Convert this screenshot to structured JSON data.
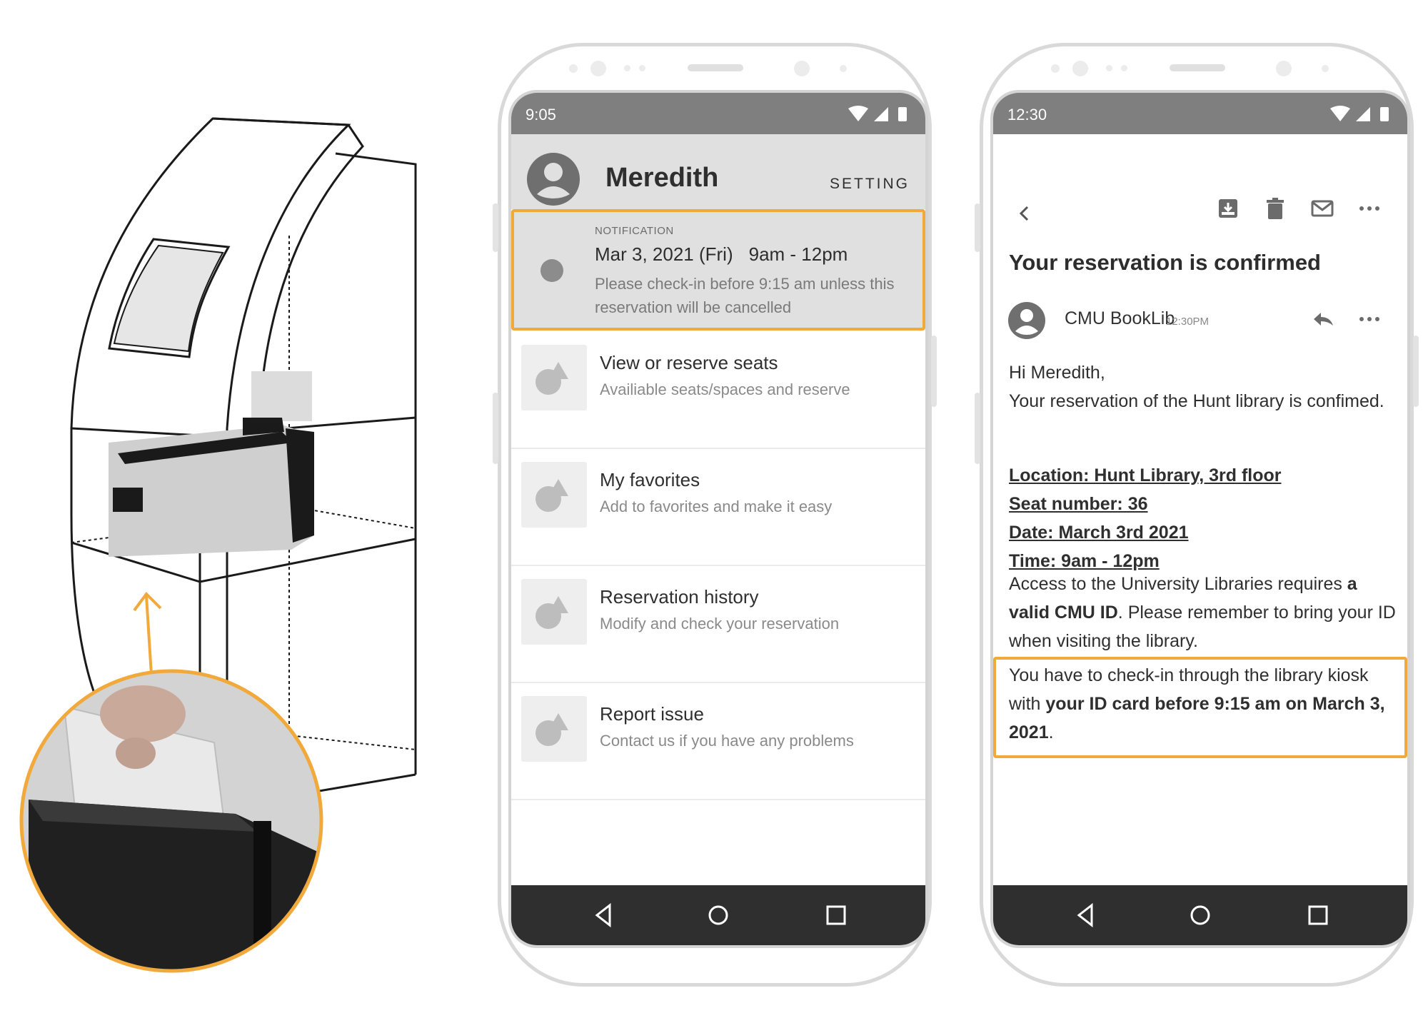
{
  "colors": {
    "accent": "#f2a93b",
    "statusbar": "#7f7f7f",
    "navbar": "#2f2f2f",
    "header": "#e0e0e0"
  },
  "phone_app": {
    "status_time": "9:05",
    "user_name": "Meredith",
    "setting_label": "SETTING",
    "notification": {
      "label": "NOTIFICATION",
      "date": "Mar 3, 2021 (Fri)",
      "time": "9am - 12pm",
      "body": "Please check-in before 9:15 am unless this reservation will be cancelled"
    },
    "menu": [
      {
        "title": "View or reserve seats",
        "subtitle": "Availiable seats/spaces and reserve",
        "icon": "shapes-icon"
      },
      {
        "title": "My favorites",
        "subtitle": "Add to favorites and make it easy",
        "icon": "shapes-icon"
      },
      {
        "title": "Reservation history",
        "subtitle": "Modify and check your reservation",
        "icon": "shapes-icon"
      },
      {
        "title": "Report issue",
        "subtitle": "Contact us if you have any problems",
        "icon": "shapes-icon"
      }
    ]
  },
  "phone_email": {
    "status_time": "12:30",
    "subject": "Your reservation is confirmed",
    "sender": "CMU BookLib",
    "sent_time": "12:30PM",
    "greeting": "Hi Meredith,",
    "intro": "Your reservation of the Hunt library is confimed.",
    "details": {
      "location": "Location: Hunt Library, 3rd floor",
      "seat": "Seat number: 36",
      "date": "Date: March 3rd 2021",
      "time": "Time: 9am - 12pm"
    },
    "access_pre": "Access to the University Libraries requires ",
    "access_bold": "a valid CMU ID",
    "access_post": ". Please remember to bring your ID when visiting the library.",
    "checkin_pre": "You have to check-in through the library kiosk with ",
    "checkin_bold": "your ID card before 9:15 am on March 3, 2021",
    "checkin_post": "."
  }
}
